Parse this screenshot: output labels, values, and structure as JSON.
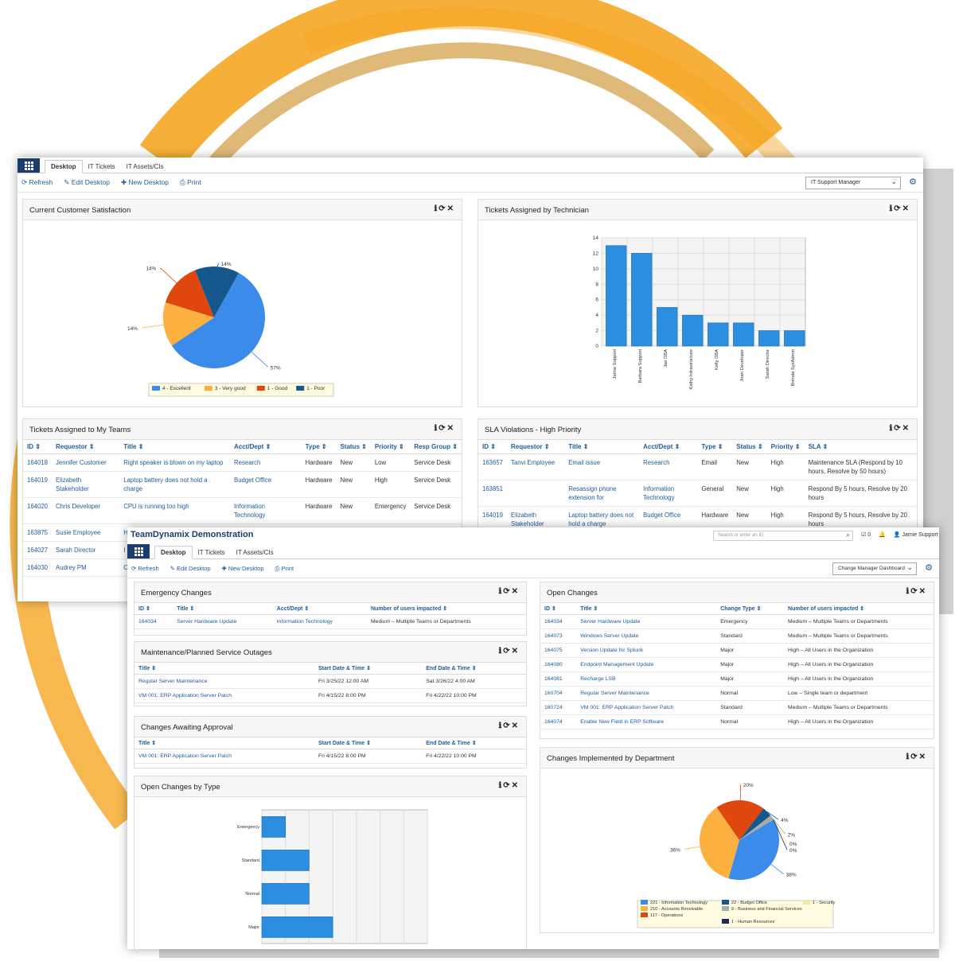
{
  "colors": {
    "orange": "#f5a623",
    "navy": "#1a3c6e",
    "link": "#1f5c99",
    "bar": "#2b8ee0"
  },
  "back": {
    "tabs": [
      "Desktop",
      "IT Tickets",
      "IT Assets/CIs"
    ],
    "toolbar": {
      "refresh": "Refresh",
      "edit": "Edit Desktop",
      "new": "New Desktop",
      "print": "Print"
    },
    "dropdown": "IT Support Manager",
    "csat": {
      "title": "Current Customer Satisfaction"
    },
    "tech": {
      "title": "Tickets Assigned by Technician"
    },
    "teams": {
      "title": "Tickets Assigned to My Teams",
      "headers": [
        "ID",
        "Requestor",
        "Title",
        "Acct/Dept",
        "Type",
        "Status",
        "Priority",
        "Resp Group"
      ],
      "rows": [
        [
          "164018",
          "Jennifer Customer",
          "Right speaker is blown on my laptop",
          "Research",
          "Hardware",
          "New",
          "Low",
          "Service Desk"
        ],
        [
          "164019",
          "Elizabeth Stakeholder",
          "Laptop battery does not hold a charge",
          "Budget Office",
          "Hardware",
          "New",
          "High",
          "Service Desk"
        ],
        [
          "164020",
          "Chris Developer",
          "CPU is running too high",
          "Information Technology",
          "Hardware",
          "New",
          "Emergency",
          "Service Desk"
        ],
        [
          "163875",
          "Susie Employee",
          "Hardwa",
          "",
          "",
          "",
          "",
          ""
        ],
        [
          "164027",
          "Sarah Director",
          "I keep g reminde dismiss",
          "",
          "",
          "",
          "",
          ""
        ],
        [
          "164030",
          "Audrey PM",
          "Cannot",
          "",
          "",
          "",
          "",
          ""
        ]
      ]
    },
    "sla": {
      "title": "SLA Violations - High Priority",
      "headers": [
        "ID",
        "Requestor",
        "Title",
        "Acct/Dept",
        "Type",
        "Status",
        "Priority",
        "SLA"
      ],
      "rows": [
        [
          "163657",
          "Tanvi Employee",
          "Email issue",
          "Research",
          "Email",
          "New",
          "High",
          "Maintenance SLA (Respond by 10 hours, Resolve by 50 hours)"
        ],
        [
          "163851",
          "",
          "Resassign phone extension for",
          "Information Technology",
          "General",
          "New",
          "High",
          "Respond By 5 hours, Resolve by 20 hours"
        ],
        [
          "164019",
          "Elizabeth Stakeholder",
          "Laptop battery does not hold a charge",
          "Budget Office",
          "Hardware",
          "New",
          "High",
          "Respond By 5 hours, Resolve by 20 hours"
        ]
      ]
    }
  },
  "front": {
    "brand": "TeamDynamix Demonstration",
    "search_placeholder": "Search or enter an ID",
    "checks": "0",
    "user": "Jamie Support",
    "tabs": [
      "Desktop",
      "IT Tickets",
      "IT Assets/CIs"
    ],
    "toolbar": {
      "refresh": "Refresh",
      "edit": "Edit Desktop",
      "new": "New Desktop",
      "print": "Print"
    },
    "dropdown": "Change Manager Dashboard",
    "emergency": {
      "title": "Emergency Changes",
      "headers": [
        "ID",
        "Title",
        "Acct/Dept",
        "Number of users impacted"
      ],
      "rows": [
        [
          "164034",
          "Server Hardware Update",
          "Information Technology",
          "Medium – Multiple Teams or Departments"
        ]
      ]
    },
    "outages": {
      "title": "Maintenance/Planned Service Outages",
      "headers": [
        "Title",
        "Start Date & Time",
        "End Date & Time"
      ],
      "rows": [
        [
          "Regular Server Maintenance",
          "Fri 3/25/22 12:00 AM",
          "Sat 3/26/22 4:00 AM"
        ],
        [
          "VM 001: ERP Application Server Patch",
          "Fri 4/15/22 8:00 PM",
          "Fri 4/22/22 10:00 PM"
        ]
      ]
    },
    "approval": {
      "title": "Changes Awaiting Approval",
      "headers": [
        "Title",
        "Start Date & Time",
        "End Date & Time"
      ],
      "rows": [
        [
          "VM 001: ERP Application Server Patch",
          "Fri 4/15/22 8:00 PM",
          "Fri 4/22/22 10:00 PM"
        ]
      ]
    },
    "bytype": {
      "title": "Open Changes by Type"
    },
    "open": {
      "title": "Open Changes",
      "headers": [
        "ID",
        "Title",
        "Change Type",
        "Number of users impacted"
      ],
      "rows": [
        [
          "164034",
          "Server Hardware Update",
          "Emergency",
          "Medium – Multiple Teams or Departments"
        ],
        [
          "164073",
          "Windows Server Update",
          "Standard",
          "Medium – Multiple Teams or Departments"
        ],
        [
          "164075",
          "Version Update for Splunk",
          "Major",
          "High – All Users in the Organization"
        ],
        [
          "164080",
          "Endpoint Management Update",
          "Major",
          "High – All Users in the Organization"
        ],
        [
          "164081",
          "Recharge LSB",
          "Major",
          "High – All Users in the Organization"
        ],
        [
          "160704",
          "Regular Server Maintenance",
          "Normal",
          "Low – Single team or department"
        ],
        [
          "160724",
          "VM 001: ERP Application Server Patch",
          "Standard",
          "Medium – Multiple Teams or Departments"
        ],
        [
          "164074",
          "Enable New Field in ERP Software",
          "Normal",
          "High – All Users in the Organization"
        ]
      ]
    },
    "dept": {
      "title": "Changes Implemented by Department"
    }
  },
  "chart_data": [
    {
      "type": "pie",
      "slices": [
        {
          "name": "4 - Excellent",
          "value": 57,
          "color": "#3b8bea"
        },
        {
          "name": "3 - Very good",
          "value": 14,
          "color": "#fbb040"
        },
        {
          "name": "1 - Good",
          "value": 14,
          "color": "#e0470f"
        },
        {
          "name": "1 - Poor",
          "value": 14,
          "color": "#13578d"
        }
      ],
      "labels": [
        "57%",
        "14%",
        "14%",
        "14%"
      ]
    },
    {
      "type": "bar",
      "categories": [
        "Jamie Support",
        "Barbara Support",
        "Jae DBA",
        "Kathy Infrastructure",
        "Kelly DBA",
        "Joan Developer",
        "Sarah Director",
        "Brenda SysAdmin"
      ],
      "values": [
        13,
        12,
        5,
        4,
        3,
        3,
        2,
        2
      ],
      "ylim": [
        0,
        14
      ],
      "yticks": [
        0,
        2,
        4,
        6,
        8,
        10,
        12,
        14
      ]
    },
    {
      "type": "bar",
      "orientation": "horizontal",
      "categories": [
        "Emergency",
        "Standard",
        "Normal",
        "Major"
      ],
      "values": [
        1,
        2,
        2,
        3
      ],
      "xlim": [
        0,
        7
      ]
    },
    {
      "type": "pie",
      "slices": [
        {
          "name": "221 - Information Technology",
          "value": 38,
          "color": "#3b8bea"
        },
        {
          "name": "210 - Accounts Receivable",
          "value": 36,
          "color": "#fbb040"
        },
        {
          "name": "117 - Operations",
          "value": 20,
          "color": "#e0470f"
        },
        {
          "name": "22 - Budget Office",
          "value": 4,
          "color": "#13578d"
        },
        {
          "name": "9 - Business and Financial Services",
          "value": 2,
          "color": "#aaaaaa"
        },
        {
          "name": "1 - Security",
          "value": 0,
          "color": "#f2e6a0"
        },
        {
          "name": "1 - Human Resources",
          "value": 0,
          "color": "#1a2a5e"
        }
      ],
      "labels": [
        "38%",
        "36%",
        "20%",
        "4%",
        "2%",
        "0%",
        "0%"
      ]
    }
  ]
}
